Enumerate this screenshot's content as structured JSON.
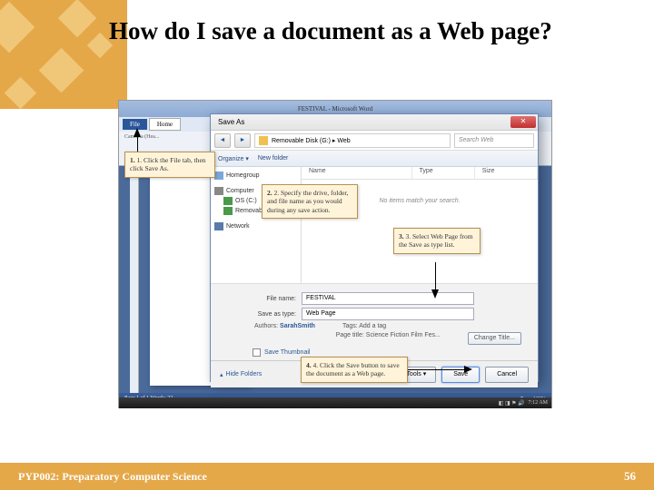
{
  "slide": {
    "title": "How do I save a document as a Web page?",
    "footer_left": "PYP002: Preparatory Computer Science",
    "footer_right": "56"
  },
  "word_window": {
    "title": "FESTIVAL - Microsoft Word",
    "tabs": {
      "file": "File",
      "home": "Home"
    },
    "ribbon_hint": "Cambria (Hea...",
    "status_left": "Page 1 of 1    Words: 22",
    "taskbar_time": "7:12 AM"
  },
  "dialog": {
    "title": "Save As",
    "nav_back": "◄",
    "nav_fwd": "►",
    "breadcrumb": "Removable Disk (G:) ▸ Web",
    "search_placeholder": "Search Web",
    "toolbar": {
      "organize": "Organize ▾",
      "newfolder": "New folder"
    },
    "tree": {
      "homegroup": "Homegroup",
      "computer": "Computer",
      "osc": "OS (C:)",
      "removable": "Removable ...",
      "network": "Network"
    },
    "list_headers": {
      "name": "Name",
      "type": "Type",
      "size": "Size"
    },
    "empty": "No items match your search.",
    "filename_label": "File name:",
    "filename_value": "FESTIVAL",
    "savetype_label": "Save as type:",
    "savetype_value": "Web Page",
    "authors_label": "Authors:",
    "authors_value": "SarahSmith",
    "tags_label": "Tags:",
    "tags_value": "Add a tag",
    "pagetitle_label": "Page title:",
    "pagetitle_value": "Science Fiction Film Fes...",
    "changetitle_btn": "Change Title...",
    "thumbnail": "Save Thumbnail",
    "hide_folders": "Hide Folders",
    "tools_btn": "Tools ▾",
    "save_btn": "Save",
    "cancel_btn": "Cancel"
  },
  "callouts": {
    "c1": "1. Click the File tab, then click Save As.",
    "c2": "2. Specify the drive, folder, and file name as you would during any save action.",
    "c3": "3. Select Web Page from the Save as type list.",
    "c4": "4. Click the Save button to save the document as a Web page."
  }
}
